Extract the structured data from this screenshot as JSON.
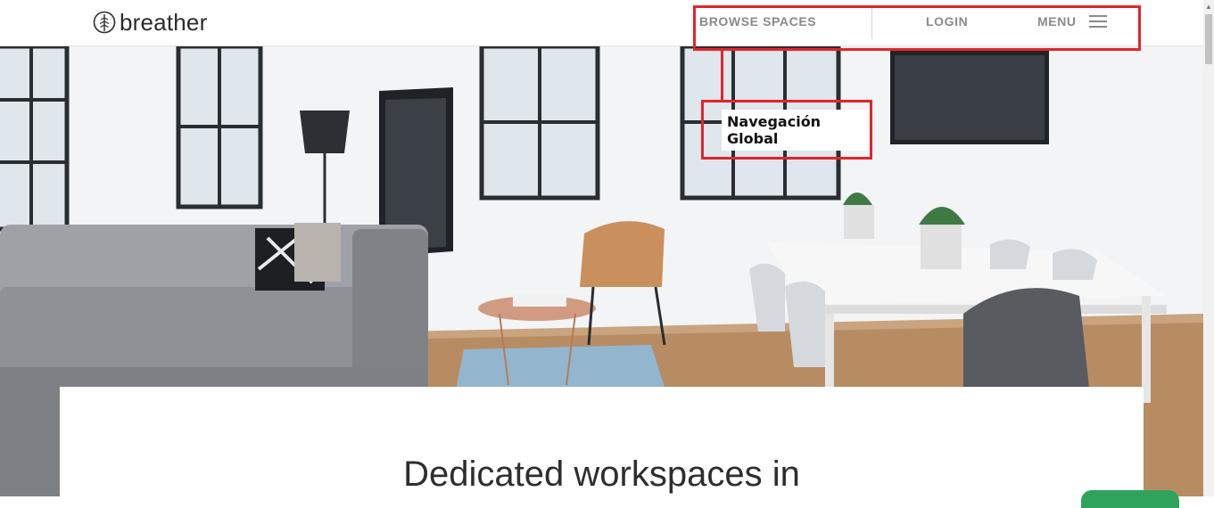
{
  "header": {
    "logo_text": "breather",
    "nav": {
      "browse": "BROWSE SPACES",
      "login": "LOGIN",
      "menu": "MENU"
    }
  },
  "annotation": {
    "label": "Navegación Global",
    "color": "#e3242b"
  },
  "hero": {
    "headline": "Dedicated workspaces in"
  },
  "icons": {
    "logo": "leaf-icon",
    "menu": "hamburger-icon"
  },
  "colors": {
    "nav_text": "#8a8a8a",
    "accent_green": "#2fa35c"
  }
}
